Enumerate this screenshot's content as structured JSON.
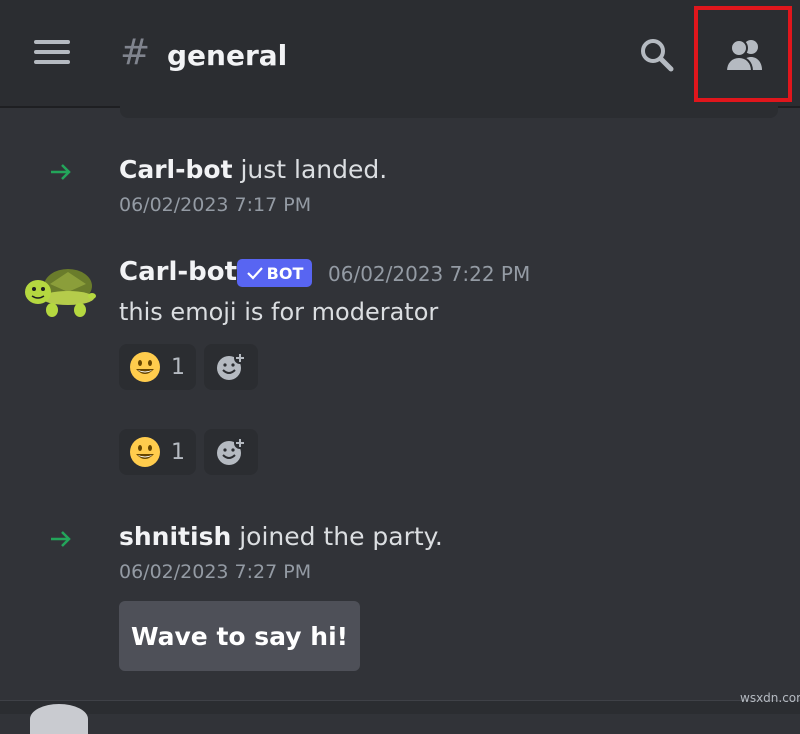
{
  "header": {
    "hash_symbol": "#",
    "channel_name": "general"
  },
  "messages": {
    "join1": {
      "username": "Carl-bot",
      "action": " just landed.",
      "timestamp": "06/02/2023 7:17 PM"
    },
    "bot_message": {
      "author": "Carl-bot",
      "bot_tag": "BOT",
      "timestamp": "06/02/2023 7:22 PM",
      "content": "this emoji is for moderator",
      "reactions": [
        {
          "emoji": "grinning-face",
          "count": "1"
        },
        {
          "emoji": "grinning-face",
          "count": "1"
        }
      ]
    },
    "join2": {
      "username": "shnitish",
      "action": " joined the party.",
      "timestamp": "06/02/2023 7:27 PM",
      "wave_button": "Wave to say hi!"
    }
  },
  "watermark": "wsxdn.com",
  "colors": {
    "accent_green": "#23a55a",
    "blurple": "#5865f2",
    "highlight_red": "#e0161c"
  }
}
